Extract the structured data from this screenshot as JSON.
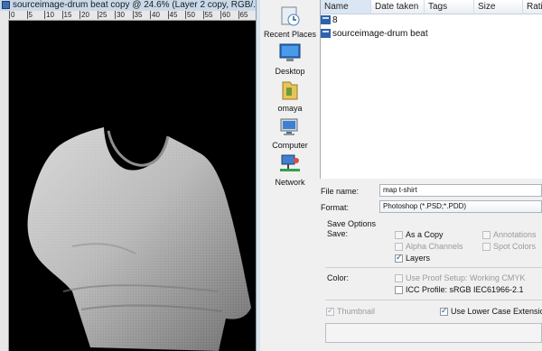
{
  "document": {
    "title": "sourceimage-drum beat copy @ 24.6% (Layer 2 copy, RGB/...",
    "ruler_ticks": [
      "0",
      "5",
      "10",
      "15",
      "20",
      "25",
      "30",
      "35",
      "40",
      "45",
      "50",
      "55",
      "60",
      "65"
    ]
  },
  "places": [
    {
      "label": "Recent Places",
      "icon": "recent-places-icon"
    },
    {
      "label": "Desktop",
      "icon": "desktop-icon"
    },
    {
      "label": "omaya",
      "icon": "user-folder-icon"
    },
    {
      "label": "Computer",
      "icon": "computer-icon"
    },
    {
      "label": "Network",
      "icon": "network-icon"
    }
  ],
  "file_list": {
    "columns": [
      "Name",
      "Date taken",
      "Tags",
      "Size",
      "Ratin"
    ],
    "rows": [
      "8",
      "sourceimage-drum beat"
    ]
  },
  "form": {
    "file_name_label": "File name:",
    "file_name_value": "map t-shirt",
    "format_label": "Format:",
    "format_value": "Photoshop (*.PSD;*.PDD)",
    "save_options_title": "Save Options",
    "save_label": "Save:",
    "as_a_copy": "As a Copy",
    "annotations": "Annotations",
    "alpha_channels": "Alpha Channels",
    "spot_colors": "Spot Colors",
    "layers": "Layers",
    "color_label": "Color:",
    "use_proof_setup": "Use Proof Setup:  Working CMYK",
    "icc_profile": "ICC Profile:  sRGB IEC61966-2.1",
    "thumbnail": "Thumbnail",
    "lower_case_ext": "Use Lower Case Extension"
  }
}
